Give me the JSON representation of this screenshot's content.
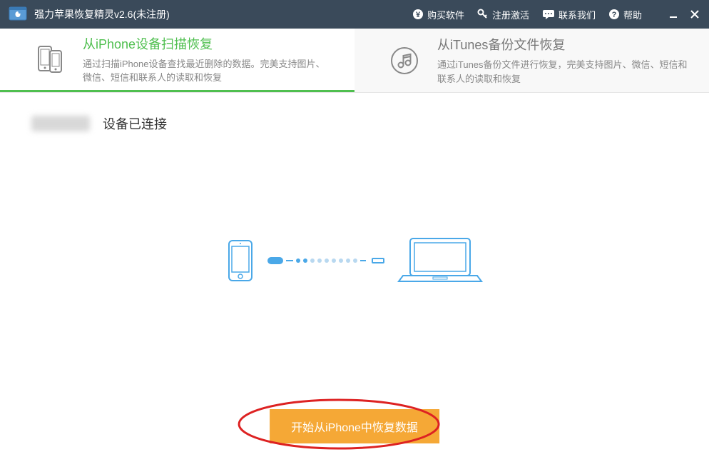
{
  "titlebar": {
    "title": "强力苹果恢复精灵v2.6(未注册)",
    "buy_label": "购买软件",
    "register_label": "注册激活",
    "contact_label": "联系我们",
    "help_label": "帮助"
  },
  "tabs": {
    "iphone": {
      "title": "从iPhone设备扫描恢复",
      "desc": "通过扫描iPhone设备查找最近删除的数据。完美支持图片、微信、短信和联系人的读取和恢复"
    },
    "itunes": {
      "title": "从iTunes备份文件恢复",
      "desc": "通过iTunes备份文件进行恢复，完美支持图片、微信、短信和联系人的读取和恢复"
    }
  },
  "content": {
    "status_label": "设备已连接",
    "start_button": "开始从iPhone中恢复数据"
  }
}
